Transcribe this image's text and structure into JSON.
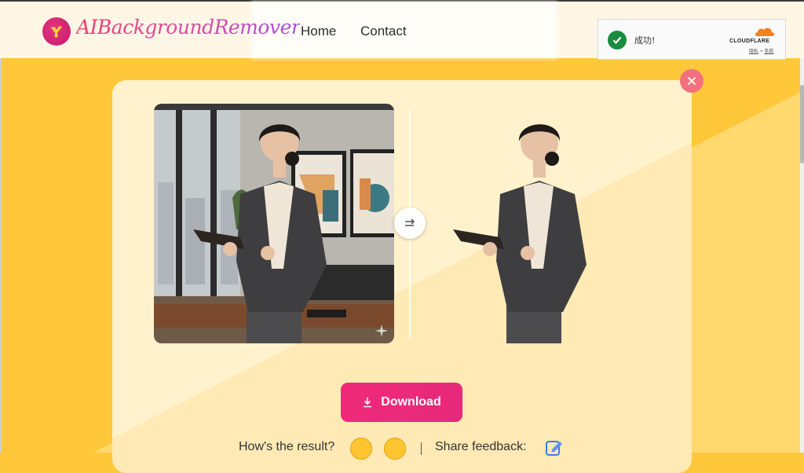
{
  "header": {
    "brand": "AIBackgroundRemover",
    "nav": [
      "Home",
      "Contact"
    ]
  },
  "cloudflare": {
    "status": "成功!",
    "logo_text": "CLOUDFLARE",
    "links": [
      "隐私",
      "条款"
    ],
    "link_sep": "•"
  },
  "main": {
    "download_label": "Download",
    "feedback_prompt": "How's the result?",
    "share_label": "Share feedback:"
  },
  "icons": {
    "logo": "logo-icon",
    "close": "close-icon",
    "compare": "compare-arrow-icon",
    "download": "download-icon",
    "edit": "edit-icon",
    "check": "check-icon",
    "sparkle": "sparkle-icon"
  },
  "colors": {
    "background": "#ffc83b",
    "card": "#fff2cc",
    "accent": "#e8297a",
    "close": "#f3707f",
    "success": "#1a8b3f"
  }
}
